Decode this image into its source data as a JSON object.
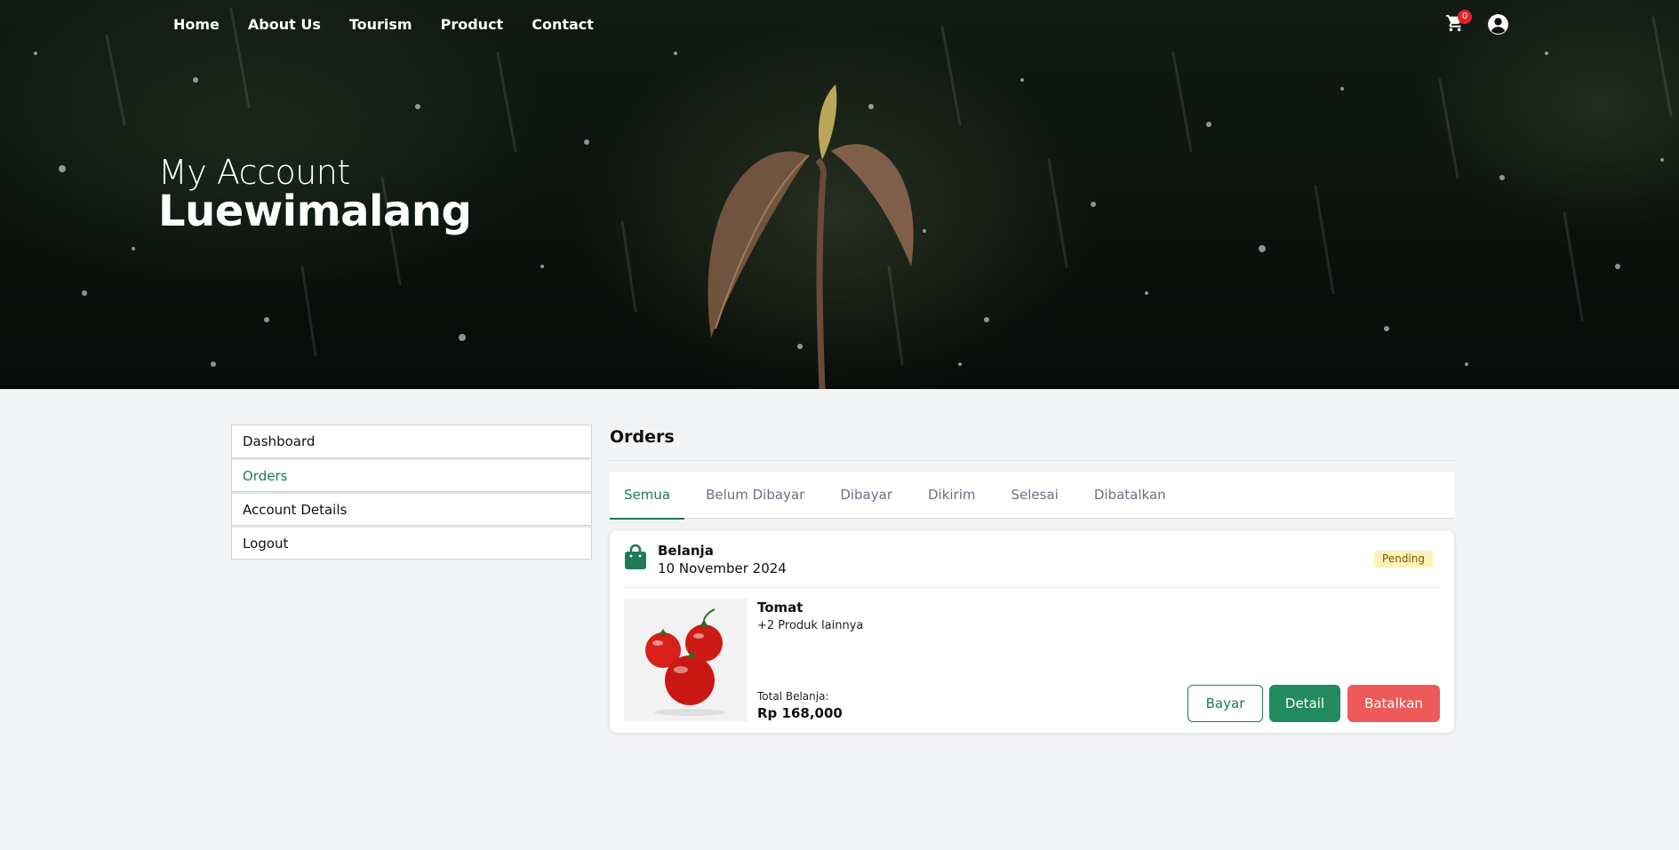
{
  "nav": {
    "items": [
      "Home",
      "About Us",
      "Tourism",
      "Product",
      "Contact"
    ],
    "cart_count": "0"
  },
  "hero": {
    "subtitle": "My Account",
    "title": "Luewimalang"
  },
  "sidebar": {
    "items": [
      {
        "label": "Dashboard",
        "active": false
      },
      {
        "label": "Orders",
        "active": true
      },
      {
        "label": "Account Details",
        "active": false
      },
      {
        "label": "Logout",
        "active": false
      }
    ]
  },
  "main": {
    "title": "Orders",
    "tabs": [
      {
        "label": "Semua",
        "active": true
      },
      {
        "label": "Belum Dibayar",
        "active": false
      },
      {
        "label": "Dibayar",
        "active": false
      },
      {
        "label": "Dikirim",
        "active": false
      },
      {
        "label": "Selesai",
        "active": false
      },
      {
        "label": "Dibatalkan",
        "active": false
      }
    ],
    "orders": [
      {
        "type": "Belanja",
        "date": "10 November 2024",
        "status": "Pending",
        "product_name": "Tomat",
        "more_products": "+2 Produk lainnya",
        "total_label": "Total Belanja:",
        "total_value": "Rp 168,000",
        "buttons": {
          "pay": "Bayar",
          "detail": "Detail",
          "cancel": "Batalkan"
        }
      }
    ]
  },
  "colors": {
    "accent": "#1f7a56",
    "danger": "#ee5a5a",
    "pending_bg": "#fdf2b8",
    "badge": "#e02424"
  },
  "icons": {
    "cart": "shopping-cart-icon",
    "user": "user-circle-icon",
    "bag": "shopping-bag-icon"
  }
}
